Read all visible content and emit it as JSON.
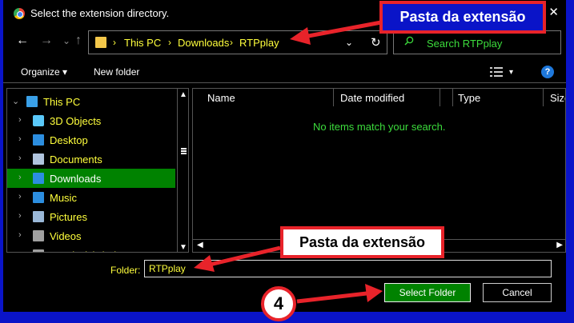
{
  "window": {
    "title": "Select the extension directory.",
    "close_glyph": "✕"
  },
  "nav": {
    "back_glyph": "←",
    "forward_glyph": "→",
    "recent_glyph": "⌄",
    "up_glyph": "↑",
    "breadcrumbs": [
      "This PC",
      "Downloads",
      "RTPplay"
    ],
    "separator": "›",
    "dropdown_glyph": "⌄",
    "refresh_glyph": "↻",
    "search_placeholder": "Search RTPplay"
  },
  "toolbar": {
    "organize_label": "Organize ▾",
    "new_folder_label": "New folder",
    "view_glyph": "▾",
    "help_glyph": "?"
  },
  "sidebar": {
    "items": [
      {
        "label": "This PC",
        "icon": "pc-icon",
        "color": "#3aa0e8",
        "selected": false
      },
      {
        "label": "3D Objects",
        "icon": "cube-icon",
        "color": "#5ac8fa",
        "selected": false
      },
      {
        "label": "Desktop",
        "icon": "desktop-icon",
        "color": "#2c8ee0",
        "selected": false
      },
      {
        "label": "Documents",
        "icon": "document-icon",
        "color": "#b0c4de",
        "selected": false
      },
      {
        "label": "Downloads",
        "icon": "download-icon",
        "color": "#2c8ee0",
        "selected": true
      },
      {
        "label": "Music",
        "icon": "music-icon",
        "color": "#2c8ee0",
        "selected": false
      },
      {
        "label": "Pictures",
        "icon": "picture-icon",
        "color": "#9ab8d8",
        "selected": false
      },
      {
        "label": "Videos",
        "icon": "video-icon",
        "color": "#a0a0a0",
        "selected": false
      },
      {
        "label": "Local Disk (C:)",
        "icon": "disk-icon",
        "color": "#a0a0a0",
        "selected": false
      }
    ],
    "arrow_glyph": "›",
    "expanded_glyph": "⌄",
    "scroll_up_glyph": "▲",
    "scroll_down_glyph": "▼"
  },
  "list": {
    "columns": [
      "Name",
      "Date modified",
      "Type",
      "Size"
    ],
    "empty_message": "No items match your search.",
    "scroll_left_glyph": "◀",
    "scroll_right_glyph": "▶"
  },
  "folder": {
    "label": "Folder:",
    "value": "RTPplay"
  },
  "buttons": {
    "select_label": "Select Folder",
    "cancel_label": "Cancel"
  },
  "annotations": {
    "callout_top": "Pasta da extensão",
    "callout_mid": "Pasta da extensão",
    "step_number": "4",
    "color": "#e8232a"
  }
}
